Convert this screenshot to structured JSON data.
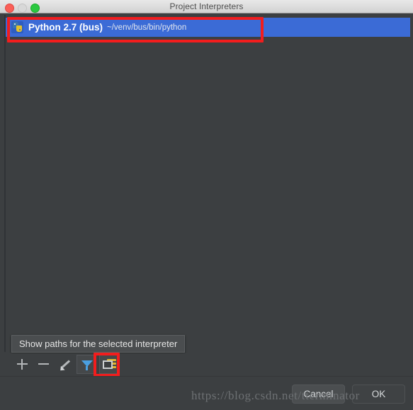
{
  "window": {
    "title": "Project Interpreters",
    "traffic_lights": [
      {
        "name": "close",
        "color": "#fa5f57"
      },
      {
        "name": "minimize",
        "color": "#d8d8d8"
      },
      {
        "name": "zoom",
        "color": "#2bc840"
      }
    ],
    "background_color": "#3c3f41",
    "accent_selection_color": "#3b6bd6",
    "callout_color": "#f21d1d"
  },
  "interpreter_list": {
    "rows": [
      {
        "icon": "python-logo-icon",
        "name": "Python 2.7 (bus)",
        "path": "~/venv/bus/bin/python",
        "selected": true
      }
    ]
  },
  "tooltip": {
    "text": "Show paths for the selected interpreter"
  },
  "toolbar": {
    "buttons": [
      {
        "icon": "plus-icon",
        "label": "+",
        "active": false
      },
      {
        "icon": "minus-icon",
        "label": "−",
        "active": false
      },
      {
        "icon": "pencil-icon",
        "label": "Edit",
        "active": false
      },
      {
        "icon": "filter-funnel-icon",
        "label": "Filter",
        "active": true
      },
      {
        "icon": "show-paths-icon",
        "label": "Show paths",
        "active": true
      }
    ]
  },
  "footer": {
    "cancel_label": "Cancel",
    "ok_label": "OK"
  },
  "watermark": {
    "text": "https://blog.csdn.net/tterminator"
  }
}
